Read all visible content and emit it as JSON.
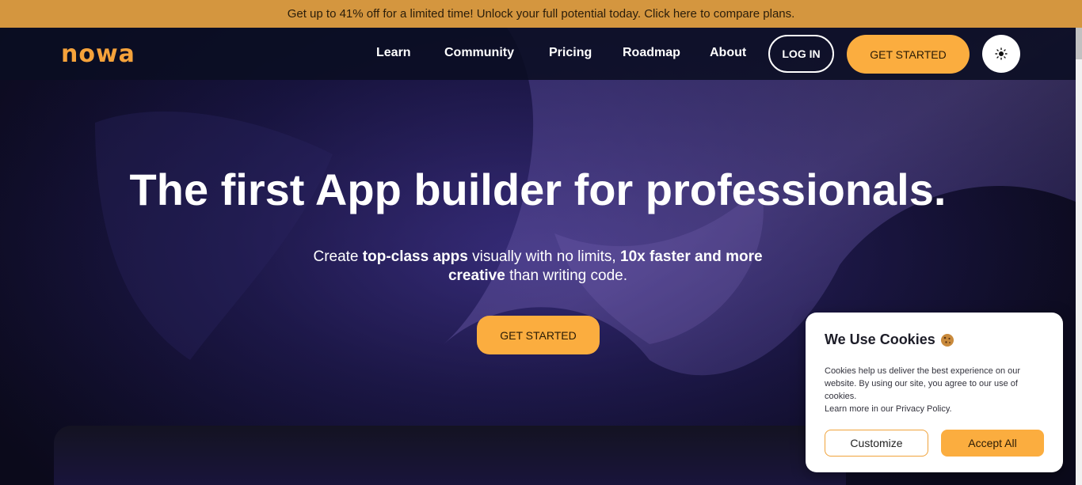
{
  "promo_banner": {
    "text": "Get up to 41% off for a limited time! Unlock your full potential today. Click here to compare plans."
  },
  "nav": {
    "logo": "nowa",
    "links": [
      "Learn",
      "Community",
      "Pricing",
      "Roadmap",
      "About"
    ],
    "login_label": "LOG IN",
    "get_started_label": "GET STARTED",
    "theme_toggle_icon": "sun-icon"
  },
  "hero": {
    "title": "The first App builder for professionals.",
    "subtitle": {
      "part1": "Create ",
      "bold1": "top-class apps",
      "part2": " visually with no limits, ",
      "bold2": "10x faster and more creative",
      "part3": " than writing code."
    },
    "cta_label": "GET STARTED"
  },
  "cookie_popup": {
    "title": "We Use Cookies",
    "title_icon": "cookie-icon",
    "body": "Cookies help us deliver the best experience on our website. By using our site, you agree to our use of cookies.",
    "learn_more": "Learn more in our Privacy Policy.",
    "customize_label": "Customize",
    "accept_label": "Accept All"
  },
  "colors": {
    "accent": "#fbad3f",
    "banner": "#d4963f",
    "logo": "#f5a23b",
    "background": "#0c0a1c"
  }
}
